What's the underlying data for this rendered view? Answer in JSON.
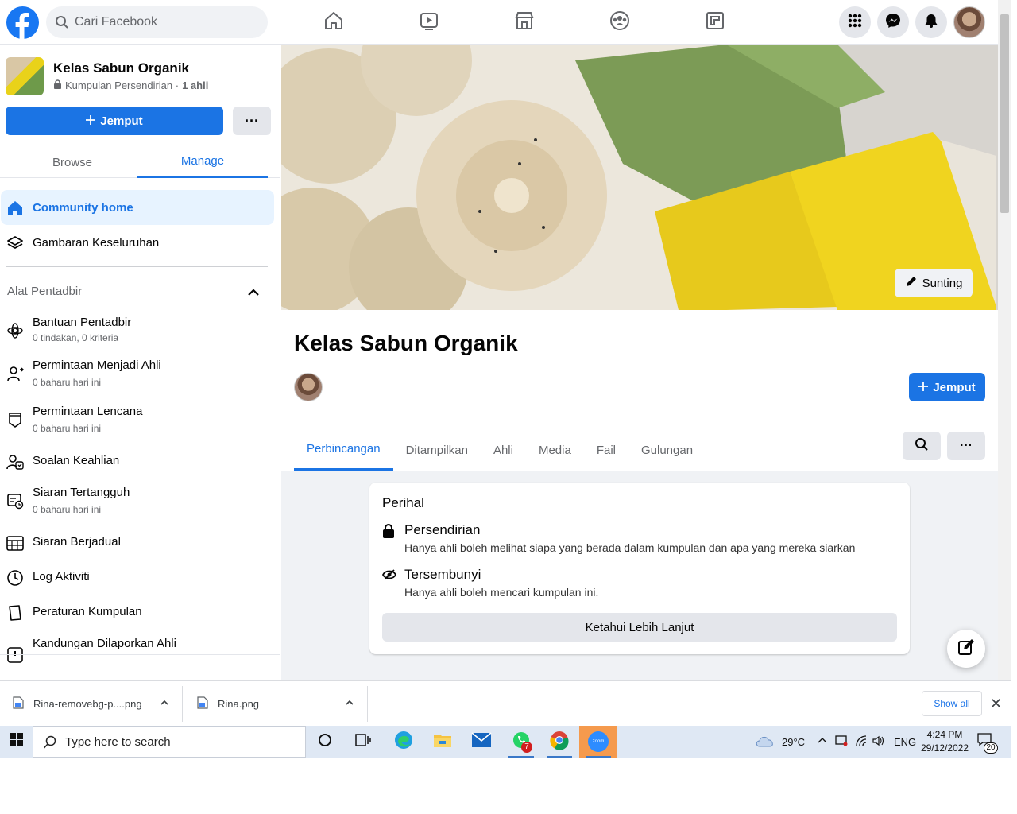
{
  "topbar": {
    "search_placeholder": "Cari Facebook"
  },
  "group": {
    "name": "Kelas Sabun Organik",
    "privacy": "Kumpulan Persendirian · ",
    "members": "1 ahli",
    "invite_label": "Jemput",
    "more_label": "···"
  },
  "sidebar": {
    "tabs": [
      "Browse",
      "Manage"
    ],
    "active_tab": "Manage",
    "nav": [
      {
        "label": "Community home",
        "icon": "home-icon",
        "active": true
      },
      {
        "label": "Gambaran Keseluruhan",
        "icon": "layers-icon"
      }
    ],
    "admin_section_title": "Alat Pentadbir",
    "admin_items": [
      {
        "label": "Bantuan Pentadbir",
        "sub": "0 tindakan, 0 kriteria",
        "icon": "admin-assist-icon"
      },
      {
        "label": "Permintaan Menjadi Ahli",
        "sub": "0 baharu hari ini",
        "icon": "member-request-icon"
      },
      {
        "label": "Permintaan Lencana",
        "sub": "0 baharu hari ini",
        "icon": "badge-icon"
      },
      {
        "label": "Soalan Keahlian",
        "sub": "",
        "icon": "questions-icon"
      },
      {
        "label": "Siaran Tertangguh",
        "sub": "0 baharu hari ini",
        "icon": "pending-posts-icon"
      },
      {
        "label": "Siaran Berjadual",
        "sub": "",
        "icon": "calendar-icon"
      },
      {
        "label": "Log Aktiviti",
        "sub": "",
        "icon": "clock-icon"
      },
      {
        "label": "Peraturan Kumpulan",
        "sub": "",
        "icon": "rules-icon"
      },
      {
        "label": "Kandungan Dilaporkan Ahli",
        "sub": "",
        "icon": "report-icon"
      }
    ]
  },
  "main": {
    "edit_cover_label": "Sunting",
    "title": "Kelas Sabun Organik",
    "invite_label": "Jemput",
    "tabs": [
      "Perbincangan",
      "Ditampilkan",
      "Ahli",
      "Media",
      "Fail",
      "Gulungan"
    ],
    "active_tab": "Perbincangan",
    "about": {
      "title": "Perihal",
      "rows": [
        {
          "title": "Persendirian",
          "desc": "Hanya ahli boleh melihat siapa yang berada dalam kumpulan dan apa yang mereka siarkan",
          "icon": "lock-icon"
        },
        {
          "title": "Tersembunyi",
          "desc": "Hanya ahli boleh mencari kumpulan ini.",
          "icon": "eye-hidden-icon"
        }
      ],
      "learn_more_label": "Ketahui Lebih Lanjut"
    }
  },
  "downloads": {
    "items": [
      "Rina-removebg-p....png",
      "Rina.png"
    ],
    "show_all_label": "Show all"
  },
  "taskbar": {
    "search_placeholder": "Type here to search",
    "whatsapp_badge": "7",
    "zoom_label": "zoom",
    "weather": "29°C",
    "language": "ENG",
    "time": "4:24 PM",
    "date": "29/12/2022",
    "notifications": "20"
  },
  "colors": {
    "fb_blue": "#1b74e4",
    "active_bg": "#e7f3ff",
    "page_bg": "#f0f2f5"
  }
}
